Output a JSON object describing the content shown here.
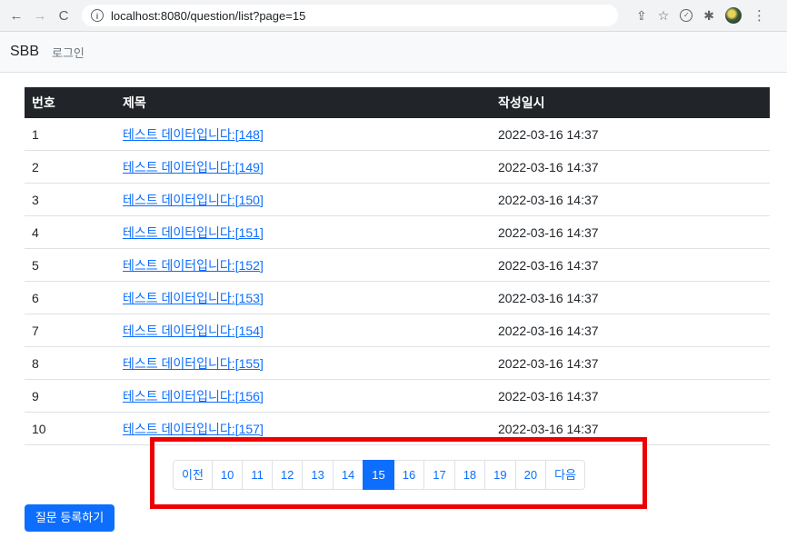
{
  "browser": {
    "back_icon": "←",
    "forward_icon": "→",
    "reload_icon": "C",
    "url": "localhost:8080/question/list?page=15",
    "icons": [
      "share-icon",
      "star-icon",
      "extension-check-icon",
      "puzzle-icon",
      "avatar",
      "menu-icon"
    ]
  },
  "nav": {
    "brand": "SBB",
    "login": "로그인"
  },
  "table": {
    "headers": [
      "번호",
      "제목",
      "작성일시"
    ],
    "rows": [
      {
        "num": "1",
        "title": "테스트 데이터입니다:[148]",
        "date": "2022-03-16 14:37"
      },
      {
        "num": "2",
        "title": "테스트 데이터입니다:[149]",
        "date": "2022-03-16 14:37"
      },
      {
        "num": "3",
        "title": "테스트 데이터입니다:[150]",
        "date": "2022-03-16 14:37"
      },
      {
        "num": "4",
        "title": "테스트 데이터입니다:[151]",
        "date": "2022-03-16 14:37"
      },
      {
        "num": "5",
        "title": "테스트 데이터입니다:[152]",
        "date": "2022-03-16 14:37"
      },
      {
        "num": "6",
        "title": "테스트 데이터입니다:[153]",
        "date": "2022-03-16 14:37"
      },
      {
        "num": "7",
        "title": "테스트 데이터입니다:[154]",
        "date": "2022-03-16 14:37"
      },
      {
        "num": "8",
        "title": "테스트 데이터입니다:[155]",
        "date": "2022-03-16 14:37"
      },
      {
        "num": "9",
        "title": "테스트 데이터입니다:[156]",
        "date": "2022-03-16 14:37"
      },
      {
        "num": "10",
        "title": "테스트 데이터입니다:[157]",
        "date": "2022-03-16 14:37"
      }
    ]
  },
  "pagination": {
    "prev": "이전",
    "pages": [
      "10",
      "11",
      "12",
      "13",
      "14",
      "15",
      "16",
      "17",
      "18",
      "19",
      "20"
    ],
    "active": "15",
    "next": "다음"
  },
  "register_button": "질문 등록하기",
  "colors": {
    "primary": "#0d6efd",
    "header_bg": "#212529",
    "highlight": "#ee0000"
  }
}
